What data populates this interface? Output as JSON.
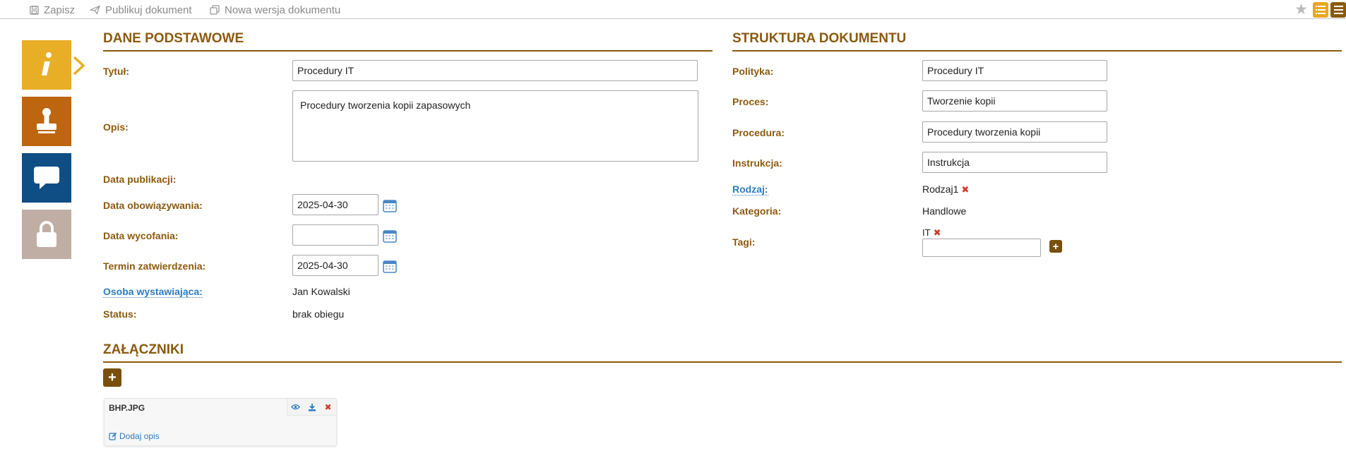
{
  "toolbar": {
    "save": "Zapisz",
    "publish": "Publikuj dokument",
    "new_version": "Nowa wersja dokumentu"
  },
  "sidebar": {
    "tabs": [
      {
        "icon": "info-icon",
        "color": "#e8ae25"
      },
      {
        "icon": "stamp-icon",
        "color": "#bd650f"
      },
      {
        "icon": "chat-icon",
        "color": "#0f4e85"
      },
      {
        "icon": "lock-icon",
        "color": "#c0aea5"
      }
    ]
  },
  "basic": {
    "title": "DANE PODSTAWOWE",
    "tytul_label": "Tytuł:",
    "tytul_value": "Procedury IT",
    "opis_label": "Opis:",
    "opis_value": "Procedury tworzenia kopii zapasowych",
    "data_publikacji_label": "Data publikacji:",
    "data_obowiazywania_label": "Data obowiązywania:",
    "data_obowiazywania_value": "2025-04-30",
    "data_wycofania_label": "Data wycofania:",
    "data_wycofania_value": "",
    "termin_label": "Termin zatwierdzenia:",
    "termin_value": "2025-04-30",
    "osoba_label": "Osoba wystawiająca:",
    "osoba_value": "Jan Kowalski",
    "status_label": "Status:",
    "status_value": "brak obiegu"
  },
  "structure": {
    "title": "STRUKTURA DOKUMENTU",
    "polityka_label": "Polityka:",
    "polityka_value": "Procedury IT",
    "proces_label": "Proces:",
    "proces_value": "Tworzenie kopii",
    "procedura_label": "Procedura:",
    "procedura_value": "Procedury tworzenia kopii",
    "instrukcja_label": "Instrukcja:",
    "instrukcja_value": "Instrukcja",
    "rodzaj_label": "Rodzaj:",
    "rodzaj_value": "Rodzaj1",
    "kategoria_label": "Kategoria:",
    "kategoria_value": "Handlowe",
    "tagi_label": "Tagi:",
    "tag_value": "IT",
    "tag_input_value": ""
  },
  "attachments": {
    "title": "ZAŁĄCZNIKI",
    "files": [
      {
        "name": "BHP.JPG",
        "add_desc": "Dodaj opis"
      }
    ]
  },
  "colors": {
    "accent": "#8b5a0e",
    "link": "#2e7bbf",
    "delete": "#d23a2b"
  }
}
